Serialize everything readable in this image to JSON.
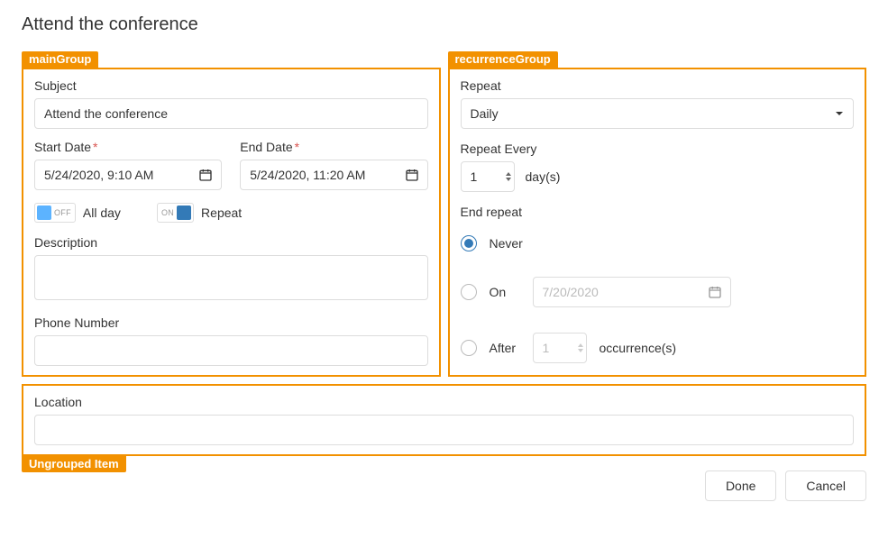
{
  "dialog": {
    "title": "Attend the conference"
  },
  "tags": {
    "main": "mainGroup",
    "recurrence": "recurrenceGroup",
    "ungrouped": "Ungrouped Item"
  },
  "main": {
    "subject_label": "Subject",
    "subject_value": "Attend the conference",
    "start_date_label": "Start Date",
    "start_date_value": "5/24/2020, 9:10 AM",
    "end_date_label": "End Date",
    "end_date_value": "5/24/2020, 11:20 AM",
    "all_day": {
      "text": "OFF",
      "label": "All day"
    },
    "repeat": {
      "text": "ON",
      "label": "Repeat"
    },
    "description_label": "Description",
    "phone_label": "Phone Number"
  },
  "recurrence": {
    "repeat_label": "Repeat",
    "repeat_value": "Daily",
    "repeat_every_label": "Repeat Every",
    "repeat_every_value": "1",
    "repeat_every_suffix": "day(s)",
    "end_repeat_label": "End repeat",
    "never_label": "Never",
    "on_label": "On",
    "on_date": "7/20/2020",
    "after_label": "After",
    "after_value": "1",
    "after_suffix": "occurrence(s)"
  },
  "ungrouped": {
    "location_label": "Location"
  },
  "footer": {
    "done": "Done",
    "cancel": "Cancel"
  }
}
